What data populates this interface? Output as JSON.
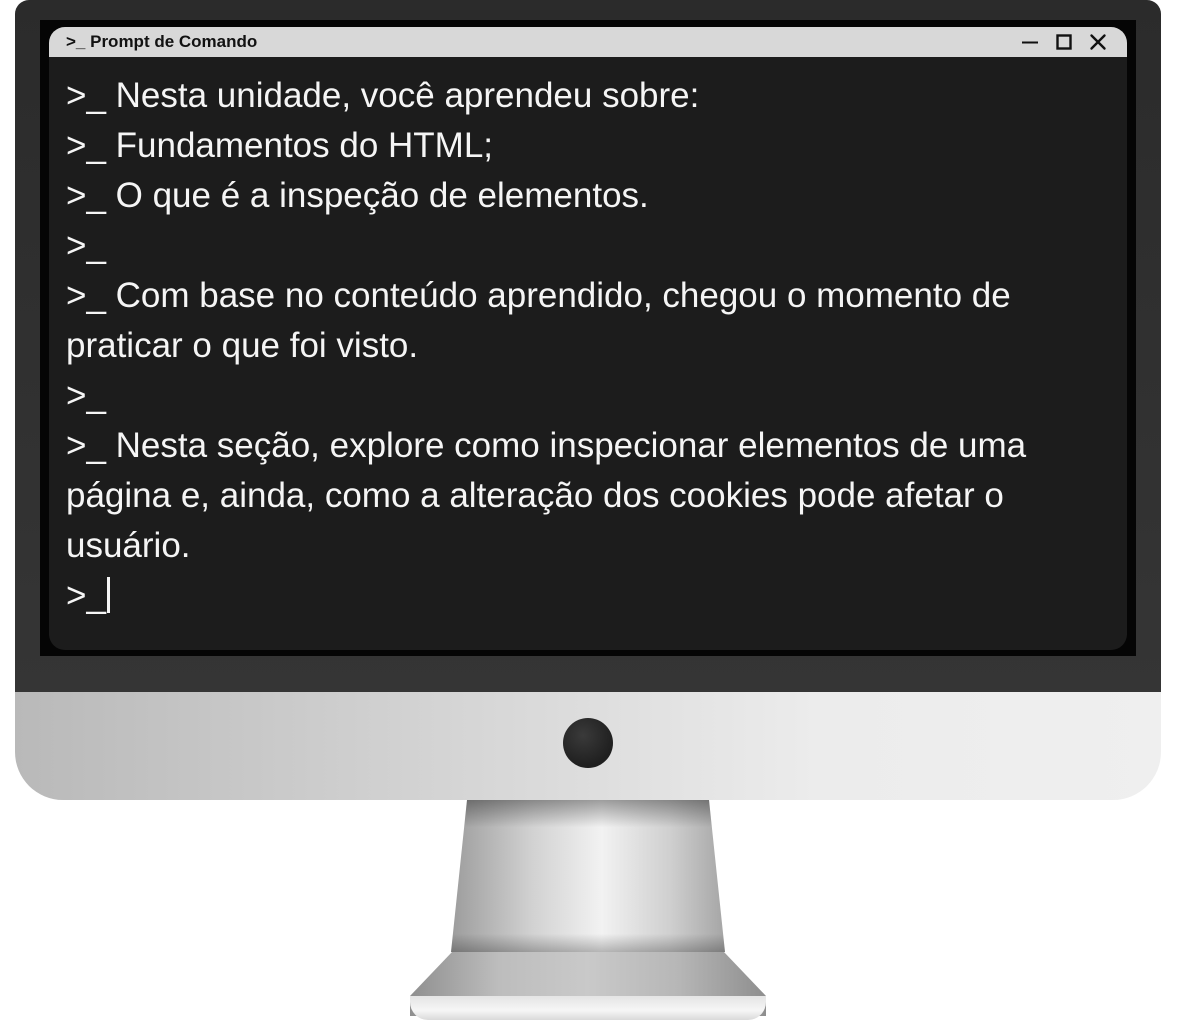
{
  "window": {
    "title": ">_ Prompt de Comando",
    "controls": [
      {
        "name": "minimize-icon",
        "glyph": "minimize"
      },
      {
        "name": "maximize-icon",
        "glyph": "maximize"
      },
      {
        "name": "close-icon",
        "glyph": "close"
      }
    ]
  },
  "terminal": {
    "lines": [
      ">_ Nesta unidade, você aprendeu sobre:",
      ">_ Fundamentos do HTML;",
      ">_ O que é a inspeção de elementos.",
      ">_",
      ">_ Com base no conteúdo aprendido, chegou o momento de praticar o que foi visto.",
      ">_",
      ">_ Nesta seção, explore como inspecionar elementos de uma página e, ainda, como a alteração dos cookies pode afetar o usuário.",
      ">_"
    ]
  },
  "colors": {
    "bezel": "#2b2b2b",
    "terminal_bg": "#1c1c1c",
    "titlebar_bg": "#d8d8d8",
    "terminal_text": "#f5f5f5"
  }
}
